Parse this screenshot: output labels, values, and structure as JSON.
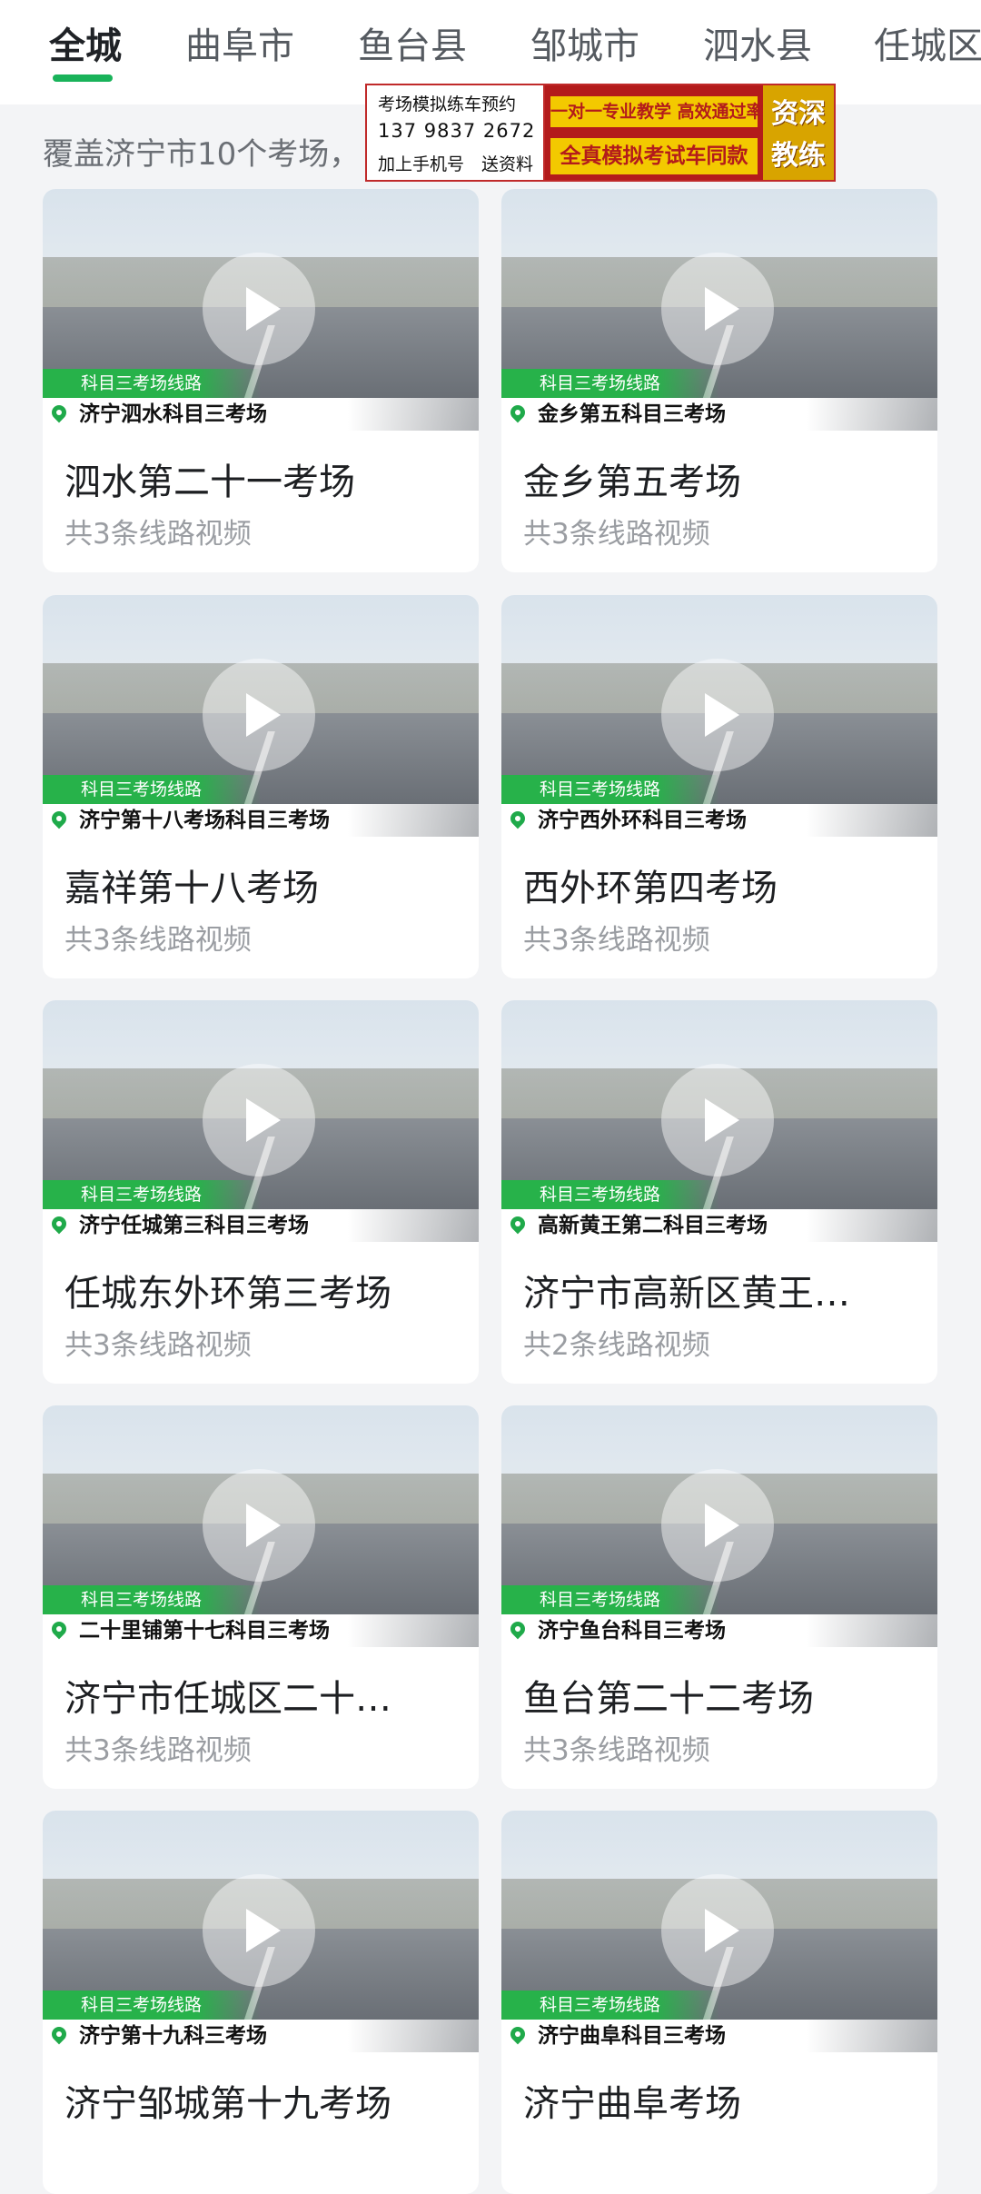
{
  "tabs": [
    "全城",
    "曲阜市",
    "鱼台县",
    "邹城市",
    "泗水县",
    "任城区"
  ],
  "active_tab": "全城",
  "coverage_text": "覆盖济宁市10个考场，",
  "ad": {
    "line1": "考场模拟练车预约",
    "phone": "137 9837 2672",
    "line3": "加上手机号　送资料",
    "slogan1": "一对一专业教学 高效通过率",
    "slogan2": "全真模拟考试车同款",
    "badge1": "资深",
    "badge2": "教练"
  },
  "cards": [
    {
      "tag": "科目三考场线路",
      "location": "济宁泗水科目三考场",
      "title": "泗水第二十一考场",
      "sub": "共3条线路视频"
    },
    {
      "tag": "科目三考场线路",
      "location": "金乡第五科目三考场",
      "title": "金乡第五考场",
      "sub": "共3条线路视频"
    },
    {
      "tag": "科目三考场线路",
      "location": "济宁第十八考场科目三考场",
      "title": "嘉祥第十八考场",
      "sub": "共3条线路视频"
    },
    {
      "tag": "科目三考场线路",
      "location": "济宁西外环科目三考场",
      "title": "西外环第四考场",
      "sub": "共3条线路视频"
    },
    {
      "tag": "科目三考场线路",
      "location": "济宁任城第三科目三考场",
      "title": "任城东外环第三考场",
      "sub": "共3条线路视频"
    },
    {
      "tag": "科目三考场线路",
      "location": "高新黄王第二科目三考场",
      "title": "济宁市高新区黄王…",
      "sub": "共2条线路视频"
    },
    {
      "tag": "科目三考场线路",
      "location": "二十里铺第十七科目三考场",
      "title": "济宁市任城区二十…",
      "sub": "共3条线路视频"
    },
    {
      "tag": "科目三考场线路",
      "location": "济宁鱼台科目三考场",
      "title": "鱼台第二十二考场",
      "sub": "共3条线路视频"
    },
    {
      "tag": "科目三考场线路",
      "location": "济宁第十九科三考场",
      "title": "济宁邹城第十九考场",
      "sub": ""
    },
    {
      "tag": "科目三考场线路",
      "location": "济宁曲阜科目三考场",
      "title": "济宁曲阜考场",
      "sub": ""
    }
  ]
}
